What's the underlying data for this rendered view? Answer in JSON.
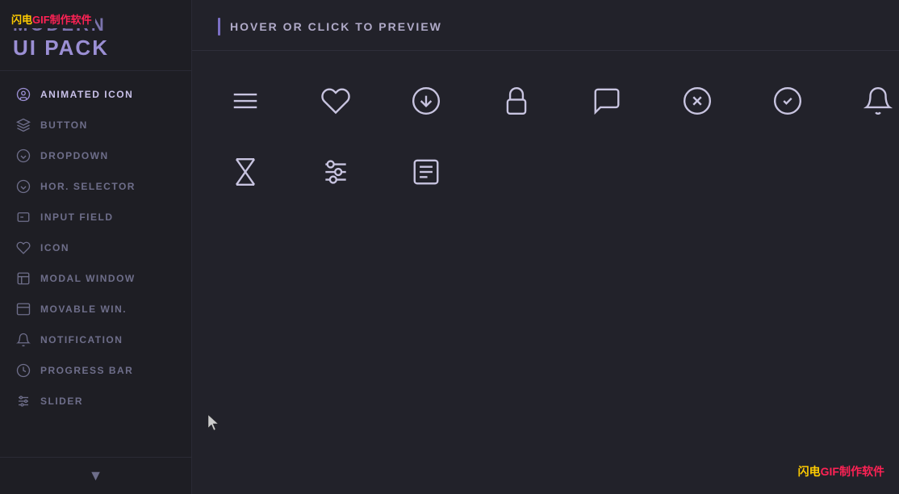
{
  "app": {
    "title_line1": "MODERN",
    "title_line2": "UI PACK",
    "watermark_top": "闪电GIF制作软件",
    "watermark_bottom": "闪电GIF制作软件"
  },
  "header": {
    "title": "HOVER OR CLICK TO PREVIEW"
  },
  "sidebar": {
    "items": [
      {
        "id": "animated-icon",
        "label": "ANIMATED ICON",
        "active": true
      },
      {
        "id": "button",
        "label": "BUTTON",
        "active": false
      },
      {
        "id": "dropdown",
        "label": "DROPDOWN",
        "active": false
      },
      {
        "id": "hor-selector",
        "label": "HOR. SELECTOR",
        "active": false
      },
      {
        "id": "input-field",
        "label": "INPUT FIELD",
        "active": false
      },
      {
        "id": "icon",
        "label": "ICON",
        "active": false
      },
      {
        "id": "modal-window",
        "label": "MODAL WINDOW",
        "active": false
      },
      {
        "id": "movable-win",
        "label": "MOVABLE WIN.",
        "active": false
      },
      {
        "id": "notification",
        "label": "NOTIFICATION",
        "active": false
      },
      {
        "id": "progress-bar",
        "label": "PROGRESS BAR",
        "active": false
      },
      {
        "id": "slider",
        "label": "SLIDER",
        "active": false
      }
    ],
    "chevron_label": "▼"
  },
  "icons_grid": {
    "row1": [
      {
        "id": "menu",
        "title": "Menu/Hamburger"
      },
      {
        "id": "heart",
        "title": "Heart/Favorite"
      },
      {
        "id": "download",
        "title": "Download"
      },
      {
        "id": "lock",
        "title": "Lock"
      },
      {
        "id": "chat",
        "title": "Chat/Message"
      },
      {
        "id": "close-circle",
        "title": "Close/X Circle"
      },
      {
        "id": "check-circle",
        "title": "Check Circle"
      },
      {
        "id": "bell",
        "title": "Bell/Notification"
      }
    ],
    "row2": [
      {
        "id": "hourglass",
        "title": "Hourglass/Timer"
      },
      {
        "id": "sliders",
        "title": "Sliders/Settings"
      },
      {
        "id": "list-doc",
        "title": "List/Document"
      }
    ]
  }
}
